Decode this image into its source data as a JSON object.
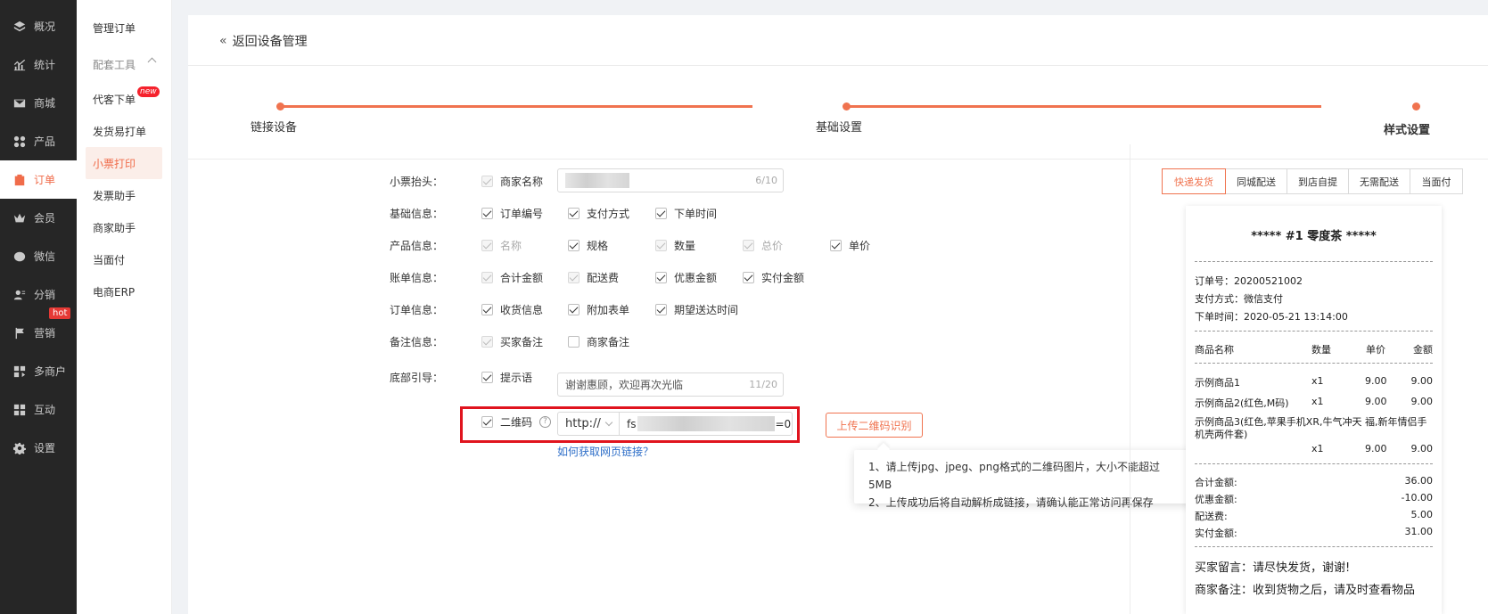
{
  "nav1": [
    {
      "label": "概况",
      "icon": "layers-icon"
    },
    {
      "label": "统计",
      "icon": "chart-icon"
    },
    {
      "label": "商城",
      "icon": "mail-icon"
    },
    {
      "label": "产品",
      "icon": "grid-icon"
    },
    {
      "label": "订单",
      "icon": "order-icon"
    },
    {
      "label": "会员",
      "icon": "crown-icon"
    },
    {
      "label": "微信",
      "icon": "wechat-icon"
    },
    {
      "label": "分销",
      "icon": "user-icon"
    },
    {
      "label": "营销",
      "icon": "flag-icon",
      "badge": "hot"
    },
    {
      "label": "多商户",
      "icon": "shop-icon"
    },
    {
      "label": "互动",
      "icon": "puzzle-icon"
    },
    {
      "label": "设置",
      "icon": "gear-icon"
    }
  ],
  "nav2": [
    {
      "label": "管理订单"
    },
    {
      "label": "配套工具"
    },
    {
      "label": "代客下单",
      "badge": "new"
    },
    {
      "label": "发货易打单"
    },
    {
      "label": "小票打印"
    },
    {
      "label": "发票助手"
    },
    {
      "label": "商家助手"
    },
    {
      "label": "当面付"
    },
    {
      "label": "电商ERP"
    }
  ],
  "back_label": "返回设备管理",
  "steps": [
    "链接设备",
    "基础设置",
    "样式设置"
  ],
  "form": {
    "header_label": "小票抬头：",
    "merchant_name": "商家名称",
    "merchant_count": "6/10",
    "basic_label": "基础信息：",
    "basic": [
      "订单编号",
      "支付方式",
      "下单时间"
    ],
    "product_label": "产品信息：",
    "product": [
      "名称",
      "规格",
      "数量",
      "总价",
      "单价"
    ],
    "bill_label": "账单信息：",
    "bill": [
      "合计金额",
      "配送费",
      "优惠金额",
      "实付金额"
    ],
    "order_label": "订单信息：",
    "order": [
      "收货信息",
      "附加表单",
      "期望送达时间"
    ],
    "remark_label": "备注信息：",
    "remark": [
      "买家备注",
      "商家备注"
    ],
    "footer_label": "底部引导：",
    "tip_label": "提示语",
    "tip_value": "谢谢惠顾，欢迎再次光临",
    "tip_count": "11/20",
    "qr_label": "二维码",
    "protocol": "http://",
    "url_prefix": "fs",
    "url_suffix": "=0",
    "upload_label": "上传二维码识别",
    "link_label": "如何获取网页链接？",
    "tooltip_1": "1、请上传jpg、jpeg、png格式的二维码图片，大小不能超过5MB",
    "tooltip_2": "2、上传成功后将自动解析成链接，请确认能正常访问再保存"
  },
  "tabs": [
    "快递发货",
    "同城配送",
    "到店自提",
    "无需配送",
    "当面付"
  ],
  "receipt": {
    "title": "***** #1  零度茶 *****",
    "order_no": "订单号：20200521002",
    "pay_method": "支付方式：微信支付",
    "order_time": "下单时间：2020-05-21 13:14:00",
    "cols": [
      "商品名称",
      "数量",
      "单价",
      "金额"
    ],
    "items": [
      {
        "name": "示例商品1",
        "qty": "x1",
        "price": "9.00",
        "amount": "9.00"
      },
      {
        "name": "示例商品2(红色,M码)",
        "qty": "x1",
        "price": "9.00",
        "amount": "9.00"
      },
      {
        "name": "示例商品3(红色,苹果手机XR,牛气冲天 福,新年情侣手机壳两件套)",
        "qty": "x1",
        "price": "9.00",
        "amount": "9.00"
      }
    ],
    "totals": [
      {
        "label": "合计金额:",
        "value": "36.00"
      },
      {
        "label": "优惠金额:",
        "value": "-10.00"
      },
      {
        "label": "配送费:",
        "value": "5.00"
      },
      {
        "label": "实付金额:",
        "value": "31.00"
      }
    ],
    "buyer_note": "买家留言：请尽快发货，谢谢!",
    "merchant_note": "商家备注：收到货物之后，请及时查看物品"
  },
  "colors": {
    "accent": "#f0734f",
    "highlight": "#e0141e",
    "sidebar": "#262626"
  }
}
